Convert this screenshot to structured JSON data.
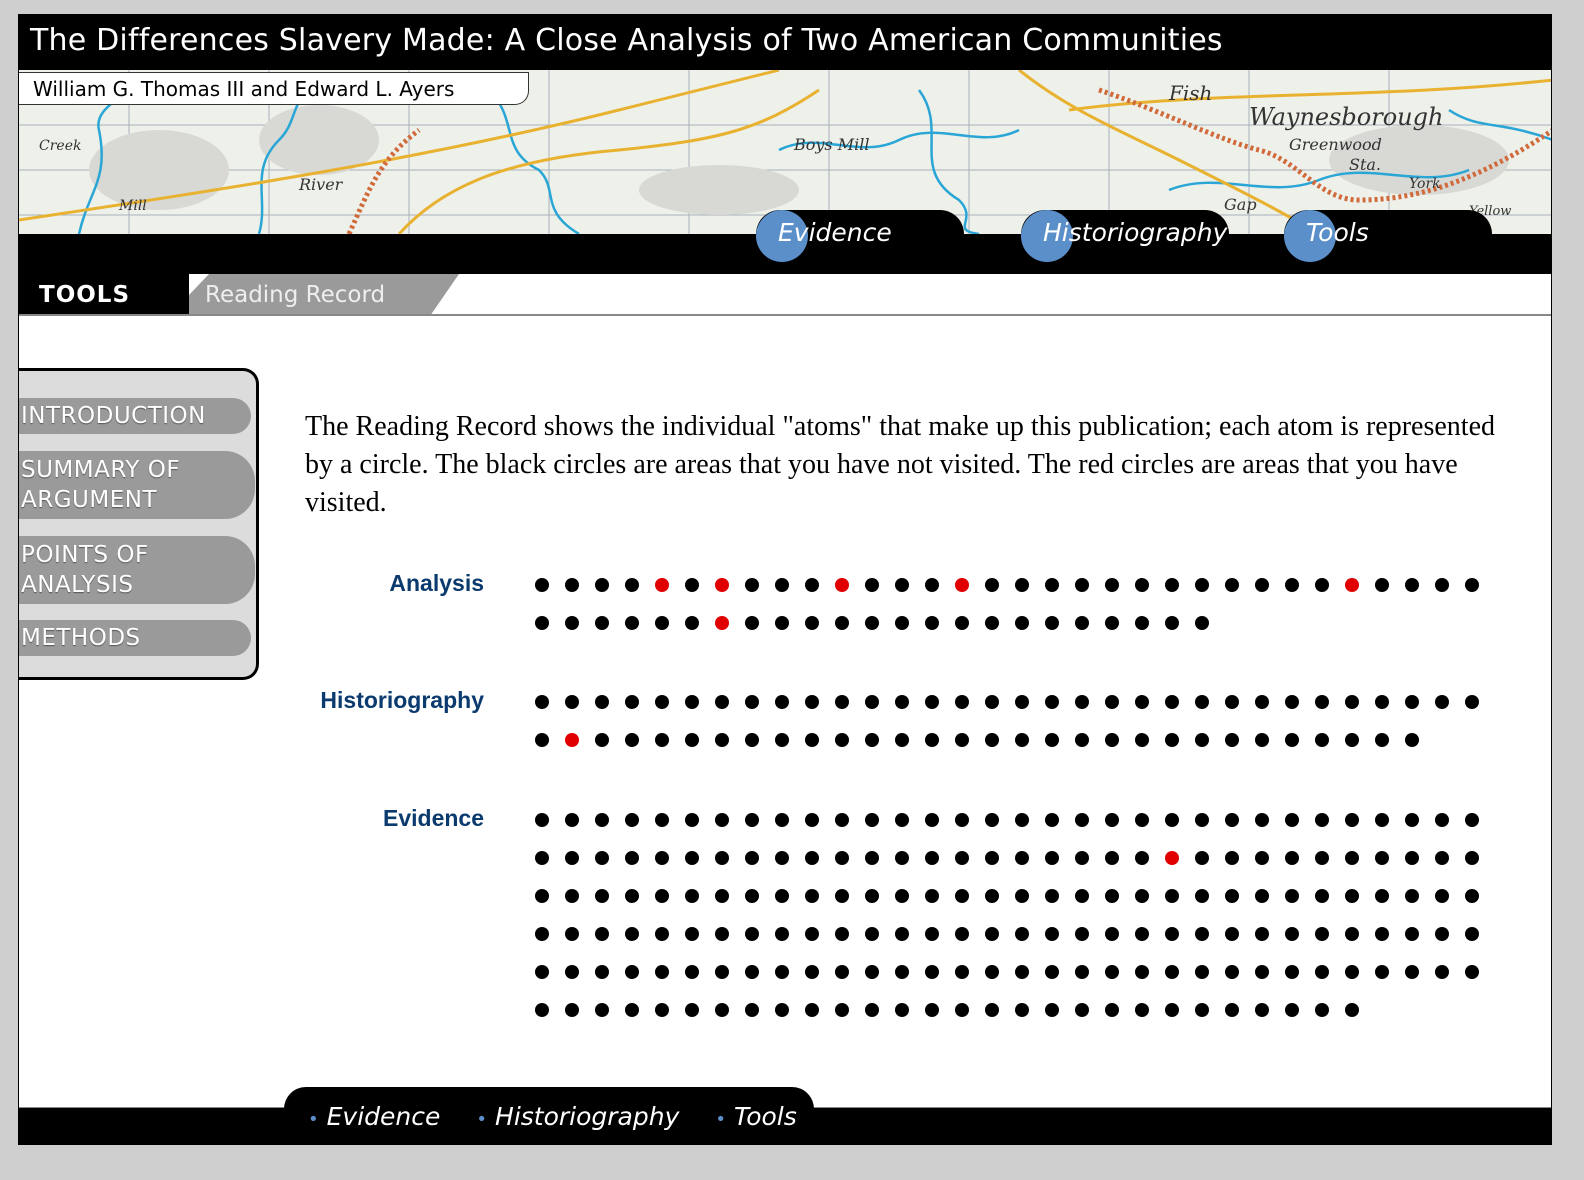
{
  "header": {
    "title": "The Differences Slavery Made: A Close Analysis of Two American Communities",
    "authors": "William G. Thomas III and Edward L. Ayers"
  },
  "map_labels": [
    "Fish",
    "Waynesborough",
    "Greenwood",
    "Sta.",
    "Boys Mill",
    "River",
    "Gap",
    "York",
    "Yellow",
    "Mill",
    "Creek"
  ],
  "nav": {
    "tabs": [
      {
        "label": "Evidence"
      },
      {
        "label": "Historiography"
      },
      {
        "label": "Tools"
      }
    ]
  },
  "section": {
    "title": "TOOLS",
    "subtitle": "Reading Record"
  },
  "sidebar": {
    "items": [
      {
        "label": "INTRODUCTION"
      },
      {
        "label": "SUMMARY OF ARGUMENT"
      },
      {
        "label": "POINTS OF ANALYSIS"
      },
      {
        "label": "METHODS"
      }
    ]
  },
  "content": {
    "intro": "The Reading Record shows the individual \"atoms\" that make up this publication; each atom is represented by a circle. The black circles are areas that you have not visited. The red circles are areas that you have visited.",
    "records": [
      {
        "label": "Analysis",
        "total": 55,
        "visited": [
          4,
          6,
          10,
          14,
          27,
          38
        ]
      },
      {
        "label": "Historiography",
        "total": 62,
        "visited": [
          33
        ]
      },
      {
        "label": "Evidence",
        "total": 188,
        "visited": [
          53
        ]
      }
    ]
  },
  "colors": {
    "visited": "#e00000",
    "unvisited": "#000000",
    "label": "#0b3a6e",
    "nav_dot": "#5b8fc9"
  },
  "footer": {
    "links": [
      {
        "label": "Evidence"
      },
      {
        "label": "Historiography"
      },
      {
        "label": "Tools"
      }
    ]
  }
}
